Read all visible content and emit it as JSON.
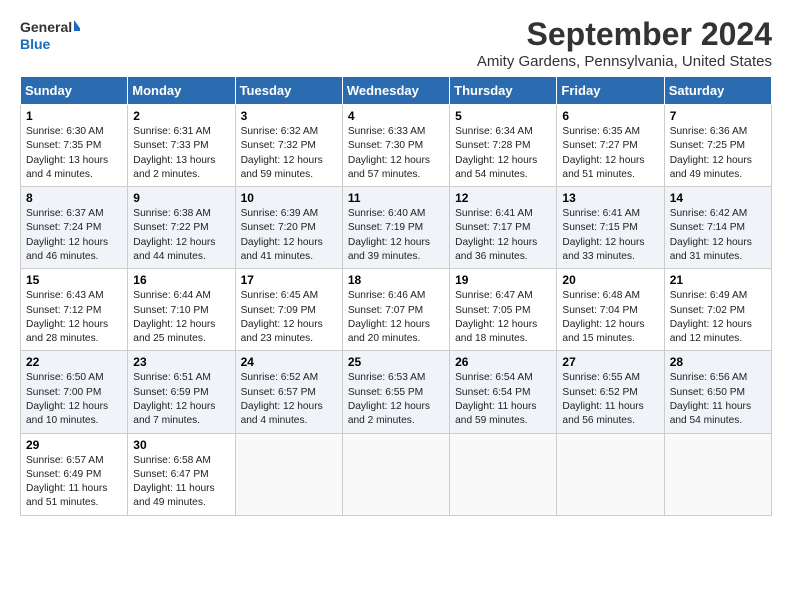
{
  "logo": {
    "general": "General",
    "blue": "Blue"
  },
  "title": "September 2024",
  "subtitle": "Amity Gardens, Pennsylvania, United States",
  "days_of_week": [
    "Sunday",
    "Monday",
    "Tuesday",
    "Wednesday",
    "Thursday",
    "Friday",
    "Saturday"
  ],
  "weeks": [
    [
      {
        "day": "1",
        "rise": "Sunrise: 6:30 AM",
        "set": "Sunset: 7:35 PM",
        "daylight": "Daylight: 13 hours and 4 minutes."
      },
      {
        "day": "2",
        "rise": "Sunrise: 6:31 AM",
        "set": "Sunset: 7:33 PM",
        "daylight": "Daylight: 13 hours and 2 minutes."
      },
      {
        "day": "3",
        "rise": "Sunrise: 6:32 AM",
        "set": "Sunset: 7:32 PM",
        "daylight": "Daylight: 12 hours and 59 minutes."
      },
      {
        "day": "4",
        "rise": "Sunrise: 6:33 AM",
        "set": "Sunset: 7:30 PM",
        "daylight": "Daylight: 12 hours and 57 minutes."
      },
      {
        "day": "5",
        "rise": "Sunrise: 6:34 AM",
        "set": "Sunset: 7:28 PM",
        "daylight": "Daylight: 12 hours and 54 minutes."
      },
      {
        "day": "6",
        "rise": "Sunrise: 6:35 AM",
        "set": "Sunset: 7:27 PM",
        "daylight": "Daylight: 12 hours and 51 minutes."
      },
      {
        "day": "7",
        "rise": "Sunrise: 6:36 AM",
        "set": "Sunset: 7:25 PM",
        "daylight": "Daylight: 12 hours and 49 minutes."
      }
    ],
    [
      {
        "day": "8",
        "rise": "Sunrise: 6:37 AM",
        "set": "Sunset: 7:24 PM",
        "daylight": "Daylight: 12 hours and 46 minutes."
      },
      {
        "day": "9",
        "rise": "Sunrise: 6:38 AM",
        "set": "Sunset: 7:22 PM",
        "daylight": "Daylight: 12 hours and 44 minutes."
      },
      {
        "day": "10",
        "rise": "Sunrise: 6:39 AM",
        "set": "Sunset: 7:20 PM",
        "daylight": "Daylight: 12 hours and 41 minutes."
      },
      {
        "day": "11",
        "rise": "Sunrise: 6:40 AM",
        "set": "Sunset: 7:19 PM",
        "daylight": "Daylight: 12 hours and 39 minutes."
      },
      {
        "day": "12",
        "rise": "Sunrise: 6:41 AM",
        "set": "Sunset: 7:17 PM",
        "daylight": "Daylight: 12 hours and 36 minutes."
      },
      {
        "day": "13",
        "rise": "Sunrise: 6:41 AM",
        "set": "Sunset: 7:15 PM",
        "daylight": "Daylight: 12 hours and 33 minutes."
      },
      {
        "day": "14",
        "rise": "Sunrise: 6:42 AM",
        "set": "Sunset: 7:14 PM",
        "daylight": "Daylight: 12 hours and 31 minutes."
      }
    ],
    [
      {
        "day": "15",
        "rise": "Sunrise: 6:43 AM",
        "set": "Sunset: 7:12 PM",
        "daylight": "Daylight: 12 hours and 28 minutes."
      },
      {
        "day": "16",
        "rise": "Sunrise: 6:44 AM",
        "set": "Sunset: 7:10 PM",
        "daylight": "Daylight: 12 hours and 25 minutes."
      },
      {
        "day": "17",
        "rise": "Sunrise: 6:45 AM",
        "set": "Sunset: 7:09 PM",
        "daylight": "Daylight: 12 hours and 23 minutes."
      },
      {
        "day": "18",
        "rise": "Sunrise: 6:46 AM",
        "set": "Sunset: 7:07 PM",
        "daylight": "Daylight: 12 hours and 20 minutes."
      },
      {
        "day": "19",
        "rise": "Sunrise: 6:47 AM",
        "set": "Sunset: 7:05 PM",
        "daylight": "Daylight: 12 hours and 18 minutes."
      },
      {
        "day": "20",
        "rise": "Sunrise: 6:48 AM",
        "set": "Sunset: 7:04 PM",
        "daylight": "Daylight: 12 hours and 15 minutes."
      },
      {
        "day": "21",
        "rise": "Sunrise: 6:49 AM",
        "set": "Sunset: 7:02 PM",
        "daylight": "Daylight: 12 hours and 12 minutes."
      }
    ],
    [
      {
        "day": "22",
        "rise": "Sunrise: 6:50 AM",
        "set": "Sunset: 7:00 PM",
        "daylight": "Daylight: 12 hours and 10 minutes."
      },
      {
        "day": "23",
        "rise": "Sunrise: 6:51 AM",
        "set": "Sunset: 6:59 PM",
        "daylight": "Daylight: 12 hours and 7 minutes."
      },
      {
        "day": "24",
        "rise": "Sunrise: 6:52 AM",
        "set": "Sunset: 6:57 PM",
        "daylight": "Daylight: 12 hours and 4 minutes."
      },
      {
        "day": "25",
        "rise": "Sunrise: 6:53 AM",
        "set": "Sunset: 6:55 PM",
        "daylight": "Daylight: 12 hours and 2 minutes."
      },
      {
        "day": "26",
        "rise": "Sunrise: 6:54 AM",
        "set": "Sunset: 6:54 PM",
        "daylight": "Daylight: 11 hours and 59 minutes."
      },
      {
        "day": "27",
        "rise": "Sunrise: 6:55 AM",
        "set": "Sunset: 6:52 PM",
        "daylight": "Daylight: 11 hours and 56 minutes."
      },
      {
        "day": "28",
        "rise": "Sunrise: 6:56 AM",
        "set": "Sunset: 6:50 PM",
        "daylight": "Daylight: 11 hours and 54 minutes."
      }
    ],
    [
      {
        "day": "29",
        "rise": "Sunrise: 6:57 AM",
        "set": "Sunset: 6:49 PM",
        "daylight": "Daylight: 11 hours and 51 minutes."
      },
      {
        "day": "30",
        "rise": "Sunrise: 6:58 AM",
        "set": "Sunset: 6:47 PM",
        "daylight": "Daylight: 11 hours and 49 minutes."
      },
      null,
      null,
      null,
      null,
      null
    ]
  ]
}
